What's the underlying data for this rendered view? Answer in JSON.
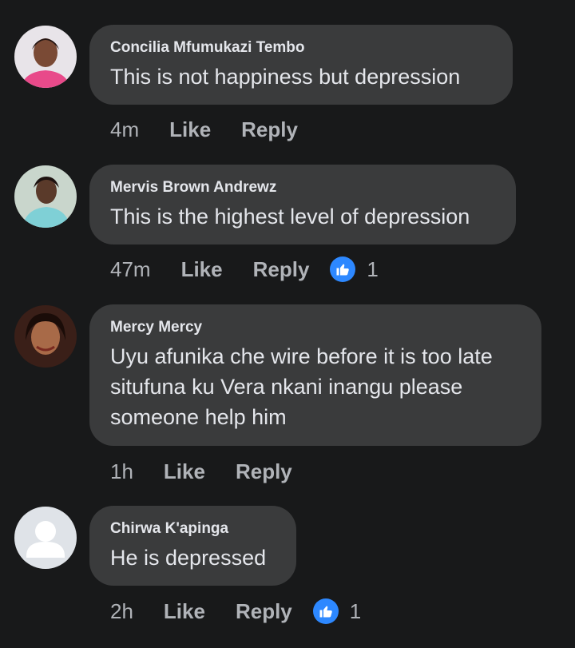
{
  "comments": [
    {
      "author": "Concilia Mfumukazi Tembo",
      "text": "This is not happiness but depression",
      "time": "4m",
      "like_label": "Like",
      "reply_label": "Reply",
      "reaction_count": null,
      "avatar_icon": "profile-photo"
    },
    {
      "author": "Mervis Brown Andrewz",
      "text": "This is the highest level of depression",
      "time": "47m",
      "like_label": "Like",
      "reply_label": "Reply",
      "reaction_count": "1",
      "avatar_icon": "profile-photo"
    },
    {
      "author": "Mercy Mercy",
      "text": "Uyu afunika che wire before it is too late\nsitufuna ku Vera nkani inangu please\nsomeone help him",
      "time": "1h",
      "like_label": "Like",
      "reply_label": "Reply",
      "reaction_count": null,
      "avatar_icon": "profile-photo"
    },
    {
      "author": "Chirwa K'apinga",
      "text": "He is depressed",
      "time": "2h",
      "like_label": "Like",
      "reply_label": "Reply",
      "reaction_count": "1",
      "avatar_icon": "default-avatar"
    }
  ],
  "colors": {
    "background": "#18191a",
    "bubble": "#3a3b3c",
    "text": "#e4e6eb",
    "meta": "#b0b3b8",
    "like_badge": "#2d88ff"
  }
}
